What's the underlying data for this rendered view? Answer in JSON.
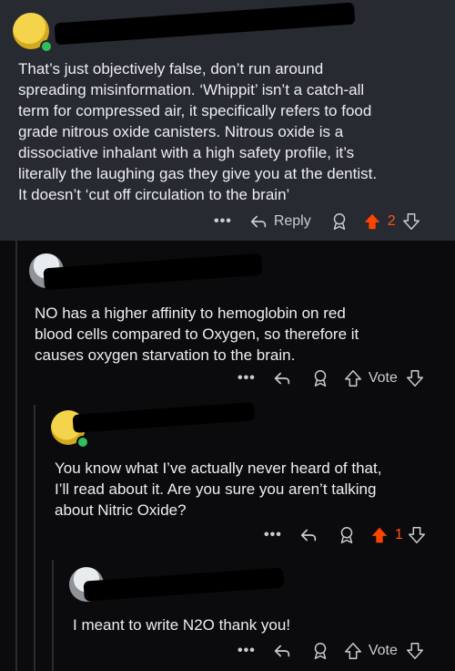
{
  "comments": [
    {
      "body": "That’s just objectively false, don’t run around\nspreading misinformation.  ‘Whippit’ isn’t a catch-all\nterm for compressed air, it specifically refers to food\ngrade nitrous oxide canisters. Nitrous oxide is a\ndissociative inhalant with a high safety profile, it’s\nliterally the laughing gas they give you at the dentist.\nIt doesn’t ‘cut off circulation to the brain’",
      "reply_label": "Reply",
      "score": "2",
      "upvoted": true
    },
    {
      "body": "NO has a higher affinity to hemoglobin on red\nblood cells compared to Oxygen, so therefore it\ncauses oxygen starvation to the brain.",
      "vote_label": "Vote"
    },
    {
      "body": "You know what I’ve actually never heard of that,\nI’ll read about it. Are you sure you aren’t talking\nabout Nitric Oxide?",
      "score": "1",
      "upvoted": true
    },
    {
      "body": "I meant to write N2O thank you!",
      "vote_label": "Vote"
    }
  ],
  "icons": {
    "more": "more-dots-icon",
    "reply": "reply-arrow-icon",
    "award": "award-icon",
    "upvote": "upvote-arrow-icon",
    "downvote": "downvote-arrow-icon"
  },
  "colors": {
    "upvote_active": "#ff4500",
    "op_background": "#272a31",
    "page_background": "#0b0b0d"
  }
}
